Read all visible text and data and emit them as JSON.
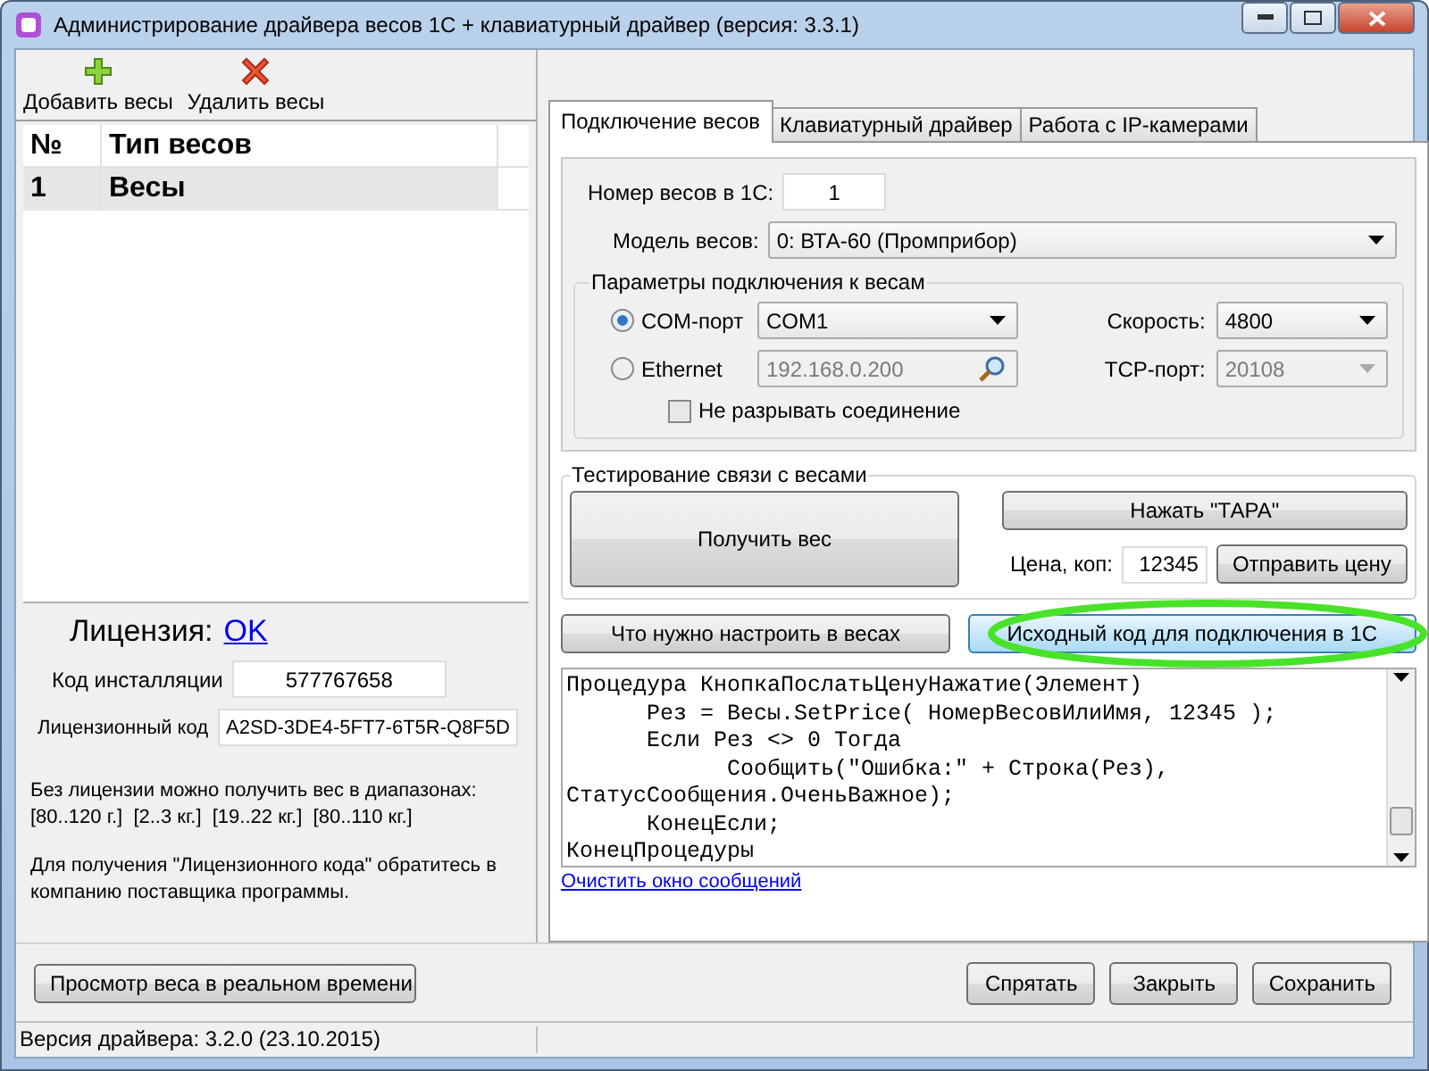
{
  "window": {
    "title": "Администрирование драйвера весов 1С + клавиатурный драйвер  (версия: 3.3.1)"
  },
  "toolbar": [
    {
      "kind": "add",
      "label": "Добавить весы"
    },
    {
      "kind": "delete",
      "label": "Удалить весы"
    }
  ],
  "scales_table": {
    "columns": [
      "№",
      "Тип весов"
    ],
    "rows": [
      {
        "cells": [
          "1",
          "Весы"
        ],
        "selected": true
      }
    ]
  },
  "license": {
    "label": "Лицензия:",
    "status": "OK",
    "install_code_label": "Код инсталляции",
    "install_code": "577767658",
    "license_code_label": "Лицензионный код",
    "license_code": "A2SD-3DE4-5FT7-6T5R-Q8F5D",
    "ranges_note": "Без лицензии можно получить вес в диапазонах:",
    "ranges": "[80..120 г.]  [2..3 кг.]  [19..22 кг.]  [80..110 кг.]",
    "contact_note": "Для получения \"Лицензионного кода\" обратитесь в компанию поставщика программы."
  },
  "tabs": [
    {
      "label": "Подключение весов",
      "selected": true
    },
    {
      "label": "Клавиатурный драйвер",
      "selected": false
    },
    {
      "label": "Работа с IP-камерами",
      "selected": false
    }
  ],
  "connection": {
    "number_label": "Номер весов в 1С:",
    "number": "1",
    "model_label": "Модель весов:",
    "model": "0:  ВТА-60  (Промприбор)",
    "group_title": "Параметры подключения к весам",
    "ports": [
      {
        "label": "COM-порт",
        "selected": true,
        "value": "COM1",
        "side_label": "Скорость:",
        "side_value": "4800"
      },
      {
        "label": "Ethernet",
        "selected": false,
        "value": "192.168.0.200",
        "side_label": "TCP-порт:",
        "side_value": "20108"
      }
    ],
    "keep_connection": {
      "label": "Не разрывать соединение",
      "checked": false
    }
  },
  "test": {
    "title": "Тестирование связи с весами",
    "get_weight": "Получить вес",
    "tare": "Нажать \"ТАРА\"",
    "price_label": "Цена, коп:",
    "price": "12345",
    "send_price": "Отправить цену"
  },
  "help_buttons": [
    {
      "label": "Что нужно настроить в весах",
      "highlighted": false
    },
    {
      "label": "Исходный код для подключения в 1С",
      "highlighted": true
    }
  ],
  "code_lines": [
    "Процедура КнопкаПослатьЦенуНажатие(Элемент)",
    "      Рез = Весы.SetPrice( НомерВесовИлиИмя, 12345 );",
    "      Если Рез <> 0 Тогда",
    "            Сообщить(\"Ошибка:\" + Строка(Рез),",
    "СтатусСообщения.ОченьВажное);",
    "      КонецЕсли;",
    "КонецПроцедуры"
  ],
  "clear_link": "Очистить окно сообщений",
  "footer": {
    "left": "Просмотр веса в реальном времени",
    "right": [
      "Спрятать",
      "Закрыть",
      "Сохранить"
    ]
  },
  "status_bar": "Версия драйвера: 3.2.0 (23.10.2015)"
}
